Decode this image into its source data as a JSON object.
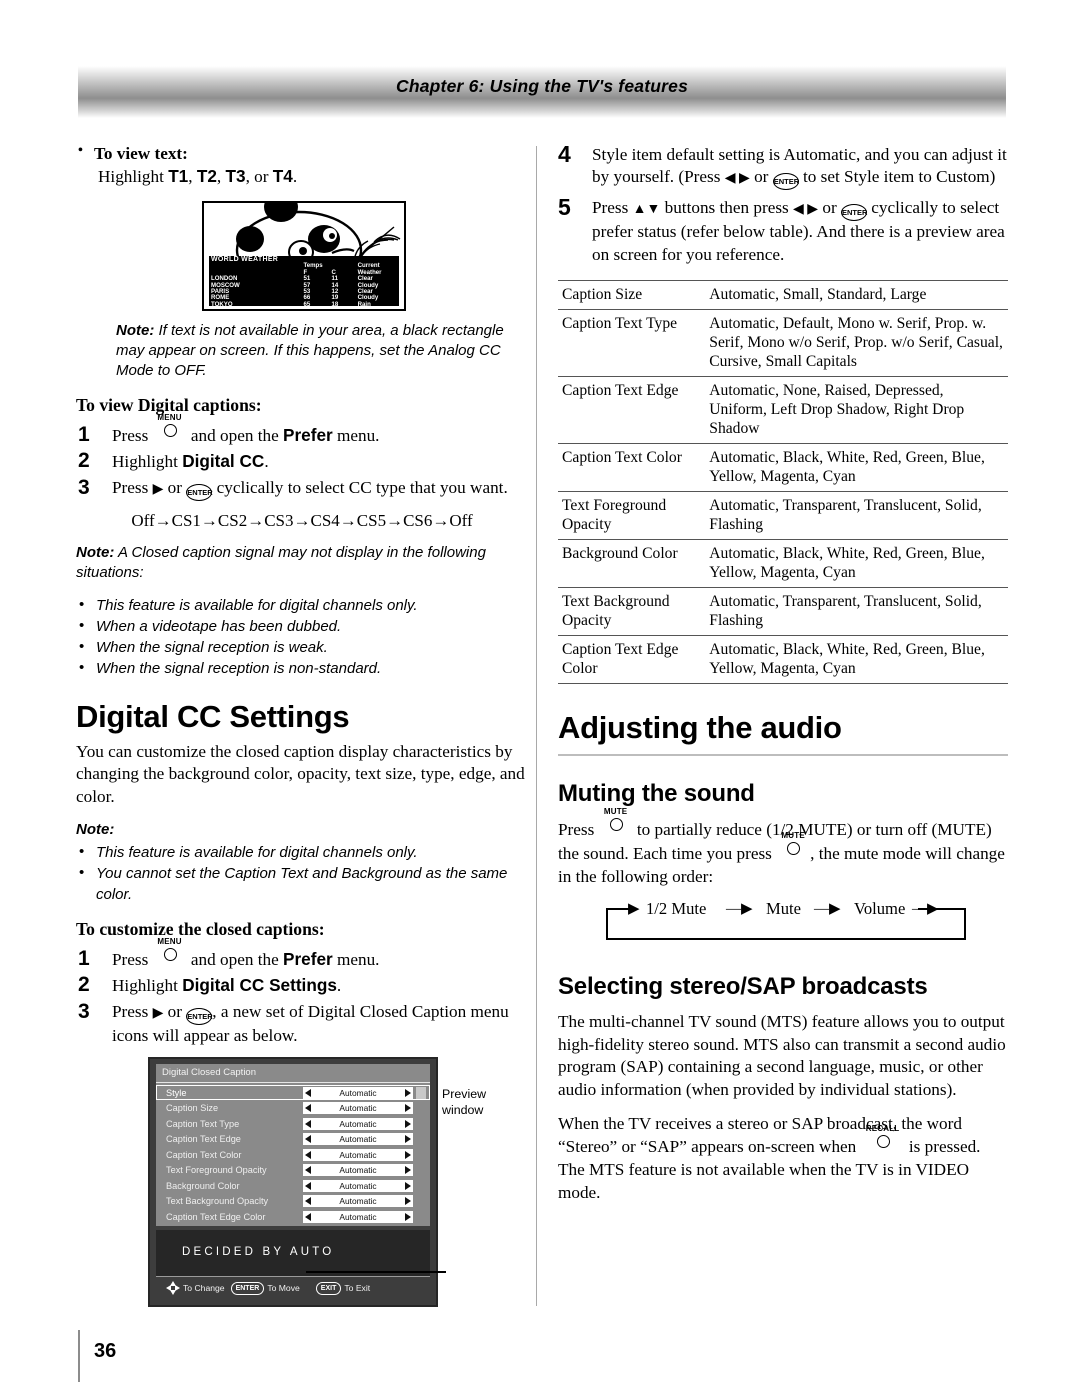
{
  "header": {
    "chapter_title": "Chapter 6: Using the TV's features"
  },
  "footer": {
    "page_number": "36"
  },
  "left_column": {
    "view_text_heading": "To view text:",
    "view_text_body_pre": "Highlight ",
    "view_text_keys": [
      "T1",
      "T2",
      "T3",
      "T4"
    ],
    "view_text_body_post": ", or ",
    "tv_figure": {
      "title": "WORLD WEATHER",
      "col_group": "Temps",
      "col_current": "Current",
      "col_weather": "Weather",
      "col_f": "F",
      "col_c": "C",
      "rows": [
        {
          "city": "LONDON",
          "f": "51",
          "c": "11",
          "weather": "Clear"
        },
        {
          "city": "MOSCOW",
          "f": "57",
          "c": "14",
          "weather": "Cloudy"
        },
        {
          "city": "PARIS",
          "f": "53",
          "c": "12",
          "weather": "Clear"
        },
        {
          "city": "ROME",
          "f": "66",
          "c": "19",
          "weather": "Cloudy"
        },
        {
          "city": "TOKYO",
          "f": "65",
          "c": "18",
          "weather": "Rain"
        }
      ]
    },
    "note_1": {
      "label": "Note:",
      "text": " If text is not available in your area, a black rectangle may appear on screen. If this happens, set the Analog CC Mode to OFF."
    },
    "digital_captions_heading": "To view Digital captions:",
    "digital_captions_steps": [
      {
        "num": "1",
        "pre": "Press ",
        "key": "MENU",
        "post": " and open the ",
        "bold": "Prefer",
        "tail": " menu."
      },
      {
        "num": "2",
        "pre": "Highlight ",
        "bold": "Digital CC",
        "tail": "."
      },
      {
        "num": "3",
        "pre": "Press ",
        "arrow": "▶",
        "mid": " or ",
        "enter": "ENTER",
        "tail": " cyclically to select CC type that you want."
      }
    ],
    "cc_cycle": "Off→CS1→CS2→CS3→CS4→CS5→CS6→Off",
    "note_2": {
      "label": "Note:",
      "text": " A Closed caption signal may not display in the following situations:",
      "items": [
        "This feature is available for digital channels only.",
        "When a videotape has been dubbed.",
        "When the signal reception is weak.",
        "When the signal reception is non-standard."
      ]
    },
    "digital_cc_settings_heading": "Digital CC Settings",
    "digital_cc_settings_body": "You can customize the closed caption display characteristics by changing the background color, opacity, text size, type, edge, and color.",
    "note_3": {
      "label": "Note:",
      "items": [
        "This feature is available for digital channels only.",
        "You cannot set the Caption Text and Background as the same color."
      ]
    },
    "customize_heading": "To customize the closed captions:",
    "customize_steps": [
      {
        "num": "1",
        "pre": "Press ",
        "key": "MENU",
        "post": " and open the ",
        "bold": "Prefer",
        "tail": " menu."
      },
      {
        "num": "2",
        "pre": "Highlight ",
        "bold": "Digital CC Settings",
        "tail": "."
      },
      {
        "num": "3",
        "pre": "Press ",
        "arrow": "▶",
        "mid": " or ",
        "enter": "ENTER",
        "tail": ", a new set of Digital Closed Caption menu icons will appear as below."
      }
    ],
    "osd": {
      "title": "Digital Closed Caption",
      "rows": [
        {
          "label": "Style",
          "value": "Automatic",
          "selected": true
        },
        {
          "label": "Caption Size",
          "value": "Automatic",
          "selected": false
        },
        {
          "label": "Caption Text Type",
          "value": "Automatic",
          "selected": false
        },
        {
          "label": "Caption Text Edge",
          "value": "Automatic",
          "selected": false
        },
        {
          "label": "Caption Text Color",
          "value": "Automatic",
          "selected": false
        },
        {
          "label": "Text Foreground Opacity",
          "value": "Automatic",
          "selected": false
        },
        {
          "label": "Background Color",
          "value": "Automatic",
          "selected": false
        },
        {
          "label": "Text Background Opaclty",
          "value": "Automatic",
          "selected": false
        },
        {
          "label": "Caption Text Edge Color",
          "value": "Automatic",
          "selected": false
        }
      ],
      "preview_text": "DECIDED BY AUTO",
      "footer_items": [
        {
          "icon": "dpad",
          "label": "To Change"
        },
        {
          "icon": "ENTER",
          "label": "To Move"
        },
        {
          "icon": "EXIT",
          "label": "To Exit"
        }
      ],
      "callout": "Preview window"
    }
  },
  "right_column": {
    "steps": [
      {
        "num": "4",
        "p1": "Style item default setting is Automatic, and you can adjust it by yourself. (Press ",
        "arrows": "◀ ▶",
        "p2": " or ",
        "enter": "ENTER",
        "p3": " to set Style item to Custom)"
      },
      {
        "num": "5",
        "p1": "Press ",
        "updown": "▲▼",
        "p2": " buttons then press ",
        "arrows": "◀ ▶",
        "p3": " or ",
        "enter": "ENTER",
        "p4": " cyclically to select prefer status (refer below table). And there is a preview area on screen for you reference."
      }
    ],
    "options_table": [
      {
        "item": "Caption Size",
        "values": "Automatic, Small, Standard, Large"
      },
      {
        "item": "Caption Text Type",
        "values": "Automatic, Default, Mono w. Serif, Prop. w. Serif, Mono w/o Serif, Prop. w/o Serif, Casual, Cursive, Small Capitals"
      },
      {
        "item": "Caption Text Edge",
        "values": "Automatic, None, Raised, Depressed, Uniform, Left Drop Shadow, Right Drop Shadow"
      },
      {
        "item": "Caption Text Color",
        "values": "Automatic, Black, White, Red, Green, Blue, Yellow, Magenta, Cyan"
      },
      {
        "item": "Text Foreground Opacity",
        "values": "Automatic, Transparent, Translucent, Solid, Flashing"
      },
      {
        "item": "Background Color",
        "values": "Automatic, Black, White, Red, Green, Blue, Yellow, Magenta, Cyan"
      },
      {
        "item": "Text Background Opacity",
        "values": "Automatic, Transparent, Translucent, Solid, Flashing"
      },
      {
        "item": "Caption Text Edge Color",
        "values": "Automatic, Black, White, Red, Green, Blue, Yellow, Magenta, Cyan"
      }
    ],
    "audio_heading": "Adjusting the audio",
    "muting_heading": "Muting the sound",
    "muting_body_1": "Press ",
    "muting_key": "MUTE",
    "muting_body_2": " to partially reduce (1/2 MUTE) or turn off (MUTE) the sound. Each time you press ",
    "muting_body_3": ", the mute mode will change in the following order:",
    "mute_flow": [
      "1/2 Mute",
      "Mute",
      "Volume"
    ],
    "sap_heading": "Selecting stereo/SAP broadcasts",
    "sap_body_1": "The multi-channel TV sound (MTS) feature allows you to output high-fidelity stereo sound. MTS also can transmit a second audio program (SAP) containing a second language, music, or other audio information (when provided by individual stations).",
    "sap_body_2a": "When the TV receives a stereo or SAP broadcast, the word “Stereo” or “SAP” appears on-screen when ",
    "sap_key": "RECALL",
    "sap_body_2b": " is pressed. The MTS feature is not available when the TV is in VIDEO mode."
  }
}
